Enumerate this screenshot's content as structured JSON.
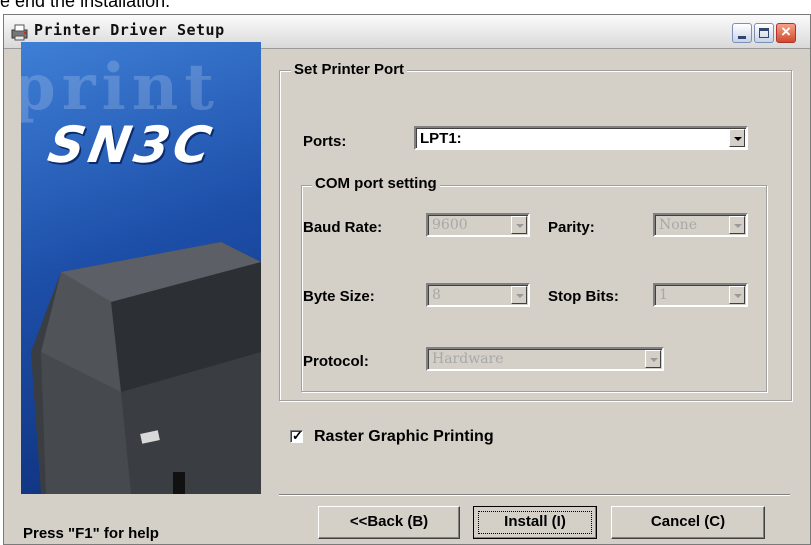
{
  "top_text": "e end the installation.",
  "window": {
    "title": "Printer Driver Setup"
  },
  "side_image": {
    "watermark": "print",
    "brand": "SN3C"
  },
  "port_group": {
    "legend": "Set Printer Port",
    "ports_label": "Ports:",
    "ports_value": "LPT1:"
  },
  "com_group": {
    "legend": "COM port setting",
    "baud_label": "Baud Rate:",
    "baud_value": "9600",
    "parity_label": "Parity:",
    "parity_value": "None",
    "bytesize_label": "Byte Size:",
    "bytesize_value": "8",
    "stopbits_label": "Stop Bits:",
    "stopbits_value": "1",
    "protocol_label": "Protocol:",
    "protocol_value": "Hardware"
  },
  "raster": {
    "label": "Raster Graphic Printing",
    "checked": true,
    "mark": "✓"
  },
  "help_text": "Press \"F1\" for help",
  "buttons": {
    "back": "<<Back (B)",
    "install": "Install (I)",
    "cancel": "Cancel (C)"
  },
  "colors": {
    "dialog_bg": "#d4d0c8",
    "side_panel": "#1d4fa9",
    "disabled_text": "#a8a8a8"
  }
}
